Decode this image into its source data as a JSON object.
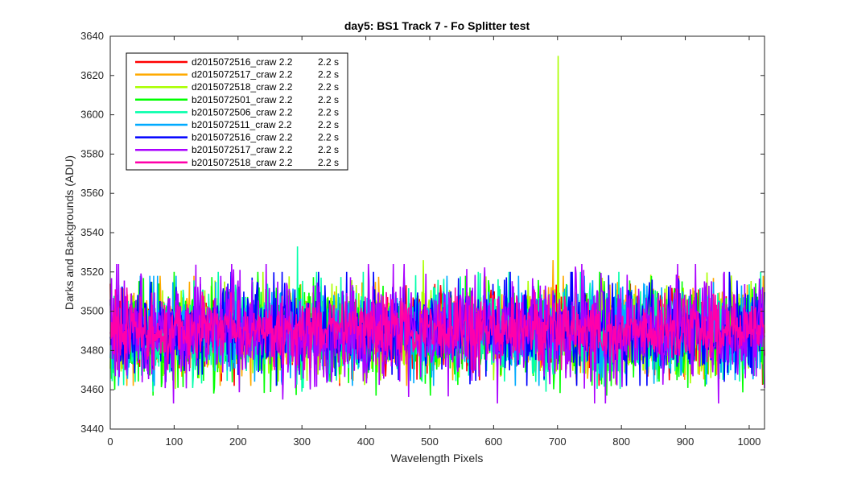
{
  "chart_data": {
    "type": "line",
    "title": "day5: BS1  Track 7 - Fo Splitter test",
    "xlabel": "Wavelength Pixels",
    "ylabel": "Darks and Backgrounds (ADU)",
    "xlim": [
      0,
      1024
    ],
    "ylim": [
      3440,
      3640
    ],
    "xticks": [
      0,
      100,
      200,
      300,
      400,
      500,
      600,
      700,
      800,
      900,
      1000
    ],
    "yticks": [
      3440,
      3460,
      3480,
      3500,
      3520,
      3540,
      3560,
      3580,
      3600,
      3620,
      3640
    ],
    "grid": false,
    "legend_position": "top-left",
    "series": [
      {
        "name": "d2015072516_craw 2.2",
        "exposure": "2.2 s",
        "color": "#ff0000",
        "mean": 3490,
        "range": [
          3462,
          3514
        ],
        "spikes": []
      },
      {
        "name": "d2015072517_craw 2.2",
        "exposure": "2.2 s",
        "color": "#ffaa00",
        "mean": 3490,
        "range": [
          3462,
          3518
        ],
        "spikes": [
          {
            "x": 693,
            "y": 3526
          }
        ]
      },
      {
        "name": "d2015072518_craw 2.2",
        "exposure": "2.2 s",
        "color": "#aaff00",
        "mean": 3490,
        "range": [
          3460,
          3520
        ],
        "spikes": [
          {
            "x": 701,
            "y": 3630
          },
          {
            "x": 490,
            "y": 3526
          }
        ]
      },
      {
        "name": "b2015072501_craw 2.2",
        "exposure": "2.2 s",
        "color": "#00ff00",
        "mean": 3489,
        "range": [
          3457,
          3520
        ],
        "spikes": []
      },
      {
        "name": "b2015072506_craw 2.2",
        "exposure": "2.2 s",
        "color": "#00ffaa",
        "mean": 3489,
        "range": [
          3459,
          3520
        ],
        "spikes": [
          {
            "x": 293,
            "y": 3533
          }
        ]
      },
      {
        "name": "b2015072511_craw 2.2",
        "exposure": "2.2 s",
        "color": "#00aaff",
        "mean": 3490,
        "range": [
          3462,
          3518
        ],
        "spikes": []
      },
      {
        "name": "b2015072516_craw 2.2",
        "exposure": "2.2 s",
        "color": "#0000ff",
        "mean": 3490,
        "range": [
          3462,
          3520
        ],
        "spikes": []
      },
      {
        "name": "b2015072517_craw 2.2",
        "exposure": "2.2 s",
        "color": "#aa00ff",
        "mean": 3490,
        "range": [
          3453,
          3524
        ],
        "spikes": [
          {
            "x": 13,
            "y": 3524
          },
          {
            "x": 952,
            "y": 3453
          }
        ]
      },
      {
        "name": "b2015072518_craw 2.2",
        "exposure": "2.2 s",
        "color": "#ff00aa",
        "mean": 3491,
        "range": [
          3470,
          3512
        ],
        "spikes": []
      }
    ]
  }
}
